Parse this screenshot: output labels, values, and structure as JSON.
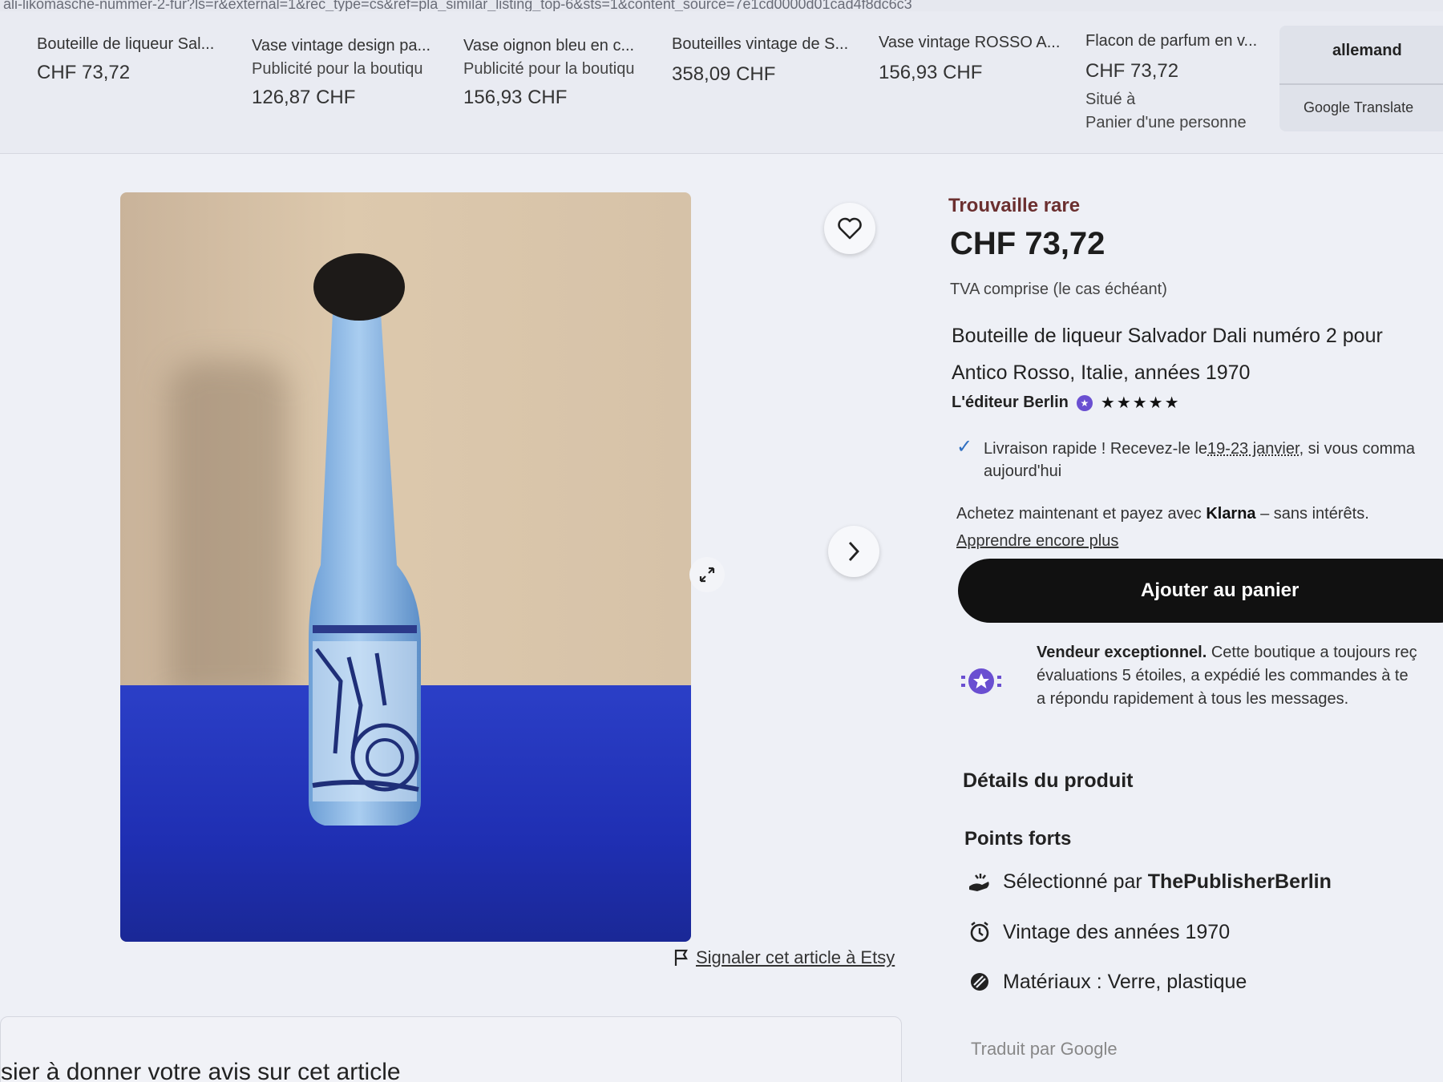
{
  "url": "ali-likomasche-nummer-2-fur?ls=r&external=1&rec_type=cs&ref=pla_similar_listing_top-6&sts=1&content_source=7e1cd0000d01cad4f8dc6c3",
  "similar": [
    {
      "title": "Bouteille de liqueur Sal...",
      "price": "CHF 73,72"
    },
    {
      "title": "Vase vintage design pa...",
      "sub": "Publicité pour la boutiqu",
      "price": "126,87 CHF"
    },
    {
      "title": "Vase oignon bleu en c...",
      "sub": "Publicité pour la boutiqu",
      "price": "156,93 CHF"
    },
    {
      "title": "Bouteilles vintage de S...",
      "price": "358,09 CHF"
    },
    {
      "title": "Vase vintage ROSSO A...",
      "price": "156,93 CHF"
    },
    {
      "title": "Flacon de parfum en v...",
      "price": "CHF 73,72",
      "sub": "Situé à",
      "sub2": "Panier d'une personne"
    }
  ],
  "translate": {
    "language": "allemand",
    "label": "Google Translate"
  },
  "listing": {
    "rare_label": "Trouvaille rare",
    "price": "CHF 73,72",
    "vat": "TVA comprise (le cas échéant)",
    "title_line1": "Bouteille de liqueur Salvador Dali numéro 2 pour",
    "title_line2": "Antico Rosso, Italie, années 1970",
    "seller": "L'éditeur Berlin",
    "stars": "★★★★★",
    "delivery_pre": "Livraison rapide ! Recevez-le le",
    "delivery_date": "19-23 janvier",
    "delivery_post": ", si vous comma",
    "delivery_line2": "aujourd'hui",
    "klarna_pre": "Achetez maintenant et payez avec ",
    "klarna_brand": "Klarna",
    "klarna_post": " – sans intérêts.",
    "klarna_link": "Apprendre encore plus",
    "cart_button": "Ajouter au panier",
    "star_seller_bold": "Vendeur exceptionnel.",
    "star_seller_text1": " Cette boutique a toujours reç",
    "star_seller_text2": "évaluations 5 étoiles, a expédié les commandes à te",
    "star_seller_text3": "a répondu rapidement à tous les messages.",
    "details_heading": "Détails du produit",
    "points_heading": "Points forts",
    "highlights": [
      {
        "pre": "Sélectionné par ",
        "bold": "ThePublisherBerlin",
        "icon": "hand-pick-icon"
      },
      {
        "pre": "Vintage des années 1970",
        "icon": "clock-icon"
      },
      {
        "pre": "Matériaux : Verre, plastique",
        "icon": "materials-icon"
      }
    ],
    "translated_by": "Traduit par Google"
  },
  "report_link": "Signaler cet article à Etsy",
  "review_prompt": "sier à donner votre avis sur cet article"
}
